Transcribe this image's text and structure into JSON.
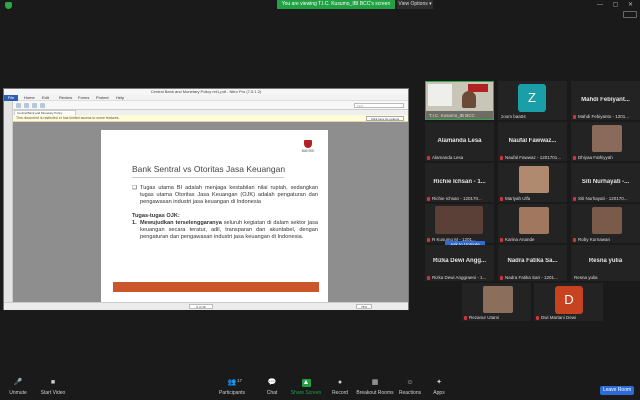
{
  "top": {
    "banner": "You are viewing T.I.C. Kusumo_IBI BCC's screen",
    "view_options": "View Options ▾",
    "win_controls": "— ▢ ✕"
  },
  "window": {
    "title": "Central Bank and Monetary Policy ret1.pdf - Nitro Pro (7.5.1.2)",
    "menu": [
      "File",
      "Home",
      "Edit",
      "Review",
      "Forms",
      "Protect",
      "Help"
    ],
    "search_placeholder": "Find",
    "tab_label": "Central Bank and Monetary Policy ...",
    "notice": "This document is restricted or has limited access to some features.",
    "notice_button": "Click here for options",
    "page_indicator": "6 of 16",
    "zoom": "75%"
  },
  "slide": {
    "logo_text": "BAKRIE",
    "title": "Bank Sentral vs Otoritas Jasa Keuangan",
    "bullet_mark": "❑",
    "bullet_text": "Tugas utama BI adalah menjaga kestabilan nilai rupiah, sedangkan tugas utama Otoritas Jasa Keuangan (OJK) adalah pengaturan dan pengawasan industri jasa keuangan di Indonesia",
    "tugas_heading": "Tugas-tugas OJK:",
    "item_num": "1.",
    "item_bold": "Mewujudkan terselenggaranya",
    "item_rest": " seluruh kegiatan di dalam sektor jasa keuangan secara teratur, adil, transparan dan akuntabel, dengan pengaturan dan pengawasan industri jasa keuangan di Indonesia."
  },
  "participants": {
    "speaker_label": "T.I.C. Kusumo_IB BCC",
    "zoom_label": "zoom baa04",
    "zoom_avatar": "Z",
    "mahdi_name": "Mahdi Febiyant...",
    "mahdi_label": "Mahdi Febiyanto - 1201...",
    "alamanda_name": "Alamanda Lesa",
    "alamanda_label": "Alamanda Lesa",
    "naufal_name": "Naufal Fawwaz...",
    "naufal_label": "Naufal Fawwaz - 1201701...",
    "dhiyaa_label": "Dhiyaa Fathiyyah",
    "richie_name": "Richie Ichsan - 1...",
    "richie_label": "Richie Ichsan - 120170...",
    "maryah_label": "Mariyah Ulfa",
    "siti_name": "Siti Nurhayati -...",
    "siti_label": "Siti Nurhayati - 120170...",
    "rkusumo_label": "R Kusumo M - 1201...",
    "karina_label": "Karina Anande",
    "roby_label": "Roby Kurnawan",
    "ask_unmute": "Ask to Unmute",
    "rizka_name": "Rizka Dewi Angg...",
    "rizka_label": "Rizka Dewi Anggraeni - 1...",
    "nadra_name": "Nadra Fatika Sa...",
    "nadra_label": "Nadra Fatika Sari - 1201...",
    "resna_name": "Resna yulia",
    "resna_label": "Resna yulia",
    "rezanur_label": "Rezanur Utami",
    "dwi_label": "Dwi Martani Dewi",
    "dwi_avatar": "D",
    "colors": {
      "zoom_avatar": "#1a9fa8",
      "dwi_avatar": "#c7421f",
      "mic_muted": "#d0343c",
      "share_green": "#21a044",
      "leave_blue": "#2d6bd8"
    }
  },
  "toolbar": {
    "unmute": "Unmute",
    "start_video": "Start Video",
    "participants": "Participants",
    "participants_count": "17",
    "chat": "Chat",
    "share_screen": "Share Screen",
    "record": "Record",
    "breakout": "Breakout Rooms",
    "reactions": "Reactions",
    "apps": "Apps",
    "leave": "Leave Room"
  }
}
